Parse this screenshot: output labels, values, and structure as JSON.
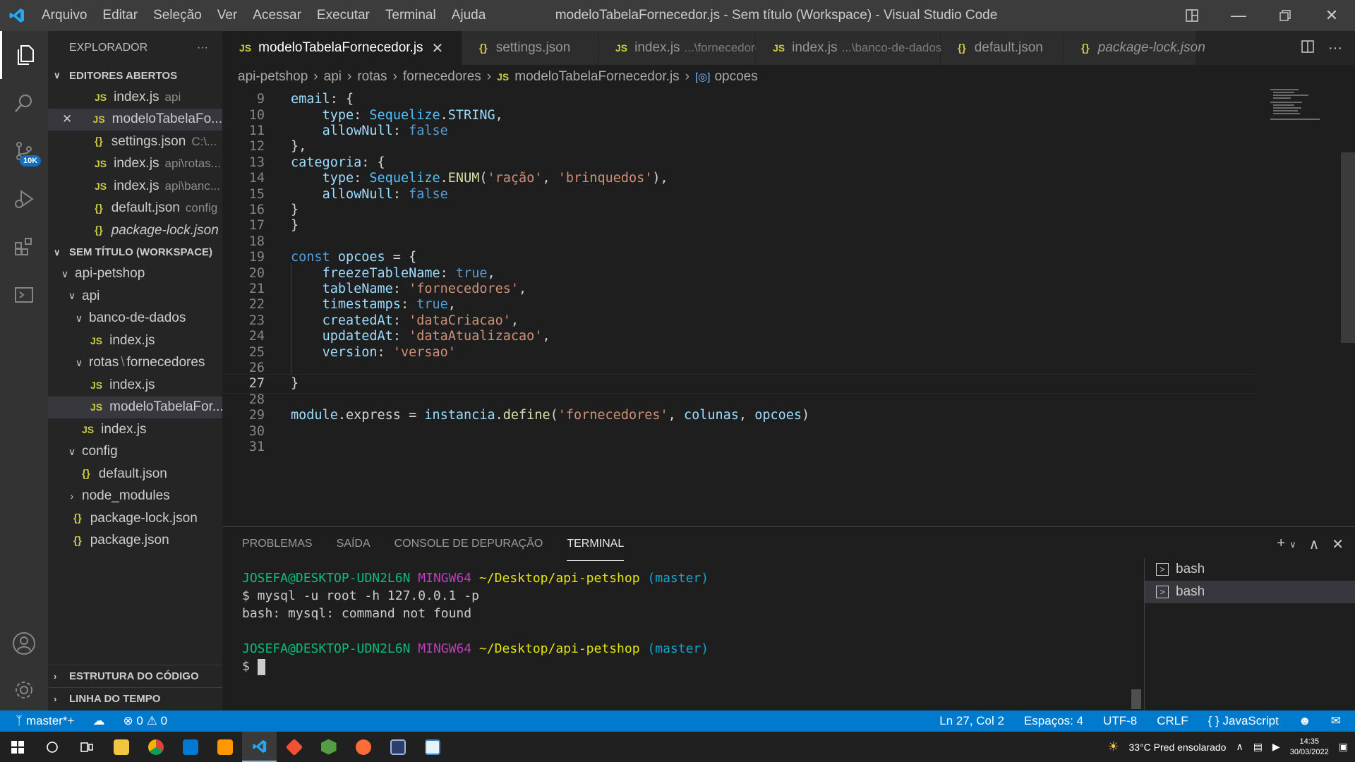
{
  "titlebar": {
    "menu": [
      "Arquivo",
      "Editar",
      "Seleção",
      "Ver",
      "Acessar",
      "Executar",
      "Terminal",
      "Ajuda"
    ],
    "title": "modeloTabelaFornecedor.js - Sem título (Workspace) - Visual Studio Code"
  },
  "activity": {
    "scm_badge": "10K"
  },
  "sidebar": {
    "header": "EXPLORADOR",
    "open_editors": {
      "title": "EDITORES ABERTOS",
      "items": [
        {
          "icon": "js",
          "name": "index.js",
          "desc": "api"
        },
        {
          "icon": "js",
          "name": "modeloTabelaFo...",
          "desc": ""
        },
        {
          "icon": "json",
          "name": "settings.json",
          "desc": "C:\\..."
        },
        {
          "icon": "js",
          "name": "index.js",
          "desc": "api\\rotas..."
        },
        {
          "icon": "js",
          "name": "index.js",
          "desc": "api\\banc..."
        },
        {
          "icon": "json",
          "name": "default.json",
          "desc": "config"
        },
        {
          "icon": "json",
          "name": "package-lock.json",
          "desc": ""
        }
      ]
    },
    "workspace": {
      "title": "SEM TÍTULO (WORKSPACE)",
      "tree": [
        {
          "name": "api-petshop",
          "type": "folder-open"
        },
        {
          "name": "api",
          "type": "folder-open"
        },
        {
          "name": "banco-de-dados",
          "type": "folder-open"
        },
        {
          "name": "index.js",
          "type": "js"
        },
        {
          "name": "rotas",
          "sep": "\\",
          "name2": "fornecedores",
          "type": "folder-open"
        },
        {
          "name": "index.js",
          "type": "js"
        },
        {
          "name": "modeloTabelaFor...",
          "type": "js"
        },
        {
          "name": "index.js",
          "type": "js"
        },
        {
          "name": "config",
          "type": "folder-open"
        },
        {
          "name": "default.json",
          "type": "json"
        },
        {
          "name": "node_modules",
          "type": "folder-closed"
        },
        {
          "name": "package-lock.json",
          "type": "json"
        },
        {
          "name": "package.json",
          "type": "json"
        }
      ]
    },
    "outline": "ESTRUTURA DO CÓDIGO",
    "timeline": "LINHA DO TEMPO"
  },
  "tabs": [
    {
      "icon": "js",
      "label": "modeloTabelaFornecedor.js",
      "desc": "",
      "active": true
    },
    {
      "icon": "json",
      "label": "settings.json",
      "desc": ""
    },
    {
      "icon": "js",
      "label": "index.js",
      "desc": "...\\fornecedores"
    },
    {
      "icon": "js",
      "label": "index.js",
      "desc": "...\\banco-de-dados"
    },
    {
      "icon": "json",
      "label": "default.json",
      "desc": ""
    },
    {
      "icon": "json",
      "label": "package-lock.json",
      "desc": ""
    }
  ],
  "breadcrumb": [
    "api-petshop",
    "api",
    "rotas",
    "fornecedores",
    "modeloTabelaFornecedor.js",
    "opcoes"
  ],
  "editor": {
    "current_line": "27",
    "lines": [
      {
        "n": "9",
        "c": "email: {"
      },
      {
        "n": "10",
        "c": "    type: Sequelize.STRING,"
      },
      {
        "n": "11",
        "c": "    allowNull: false"
      },
      {
        "n": "12",
        "c": "},"
      },
      {
        "n": "13",
        "c": "categoria: {"
      },
      {
        "n": "14",
        "c": "    type: Sequelize.ENUM('ração', 'brinquedos'),"
      },
      {
        "n": "15",
        "c": "    allowNull: false"
      },
      {
        "n": "16",
        "c": "}"
      },
      {
        "n": "17",
        "c": "}"
      },
      {
        "n": "18",
        "c": ""
      },
      {
        "n": "19",
        "c": "const opcoes = {"
      },
      {
        "n": "20",
        "c": "    freezeTableName: true,"
      },
      {
        "n": "21",
        "c": "    tableName: 'fornecedores',"
      },
      {
        "n": "22",
        "c": "    timestamps: true,"
      },
      {
        "n": "23",
        "c": "    createdAt: 'dataCriacao',"
      },
      {
        "n": "24",
        "c": "    updatedAt: 'dataAtualizacao',"
      },
      {
        "n": "25",
        "c": "    version: 'versao'"
      },
      {
        "n": "26",
        "c": ""
      },
      {
        "n": "27",
        "c": "}"
      },
      {
        "n": "28",
        "c": ""
      },
      {
        "n": "29",
        "c": "module.express = instancia.define('fornecedores', colunas, opcoes)"
      },
      {
        "n": "30",
        "c": ""
      },
      {
        "n": "31",
        "c": ""
      }
    ]
  },
  "panel": {
    "tabs": [
      "PROBLEMAS",
      "SAÍDA",
      "CONSOLE DE DEPURAÇÃO",
      "TERMINAL"
    ],
    "active_tab": "TERMINAL",
    "terminal": {
      "user": "JOSEFA@DESKTOP-UDN2L6N",
      "env": "MINGW64",
      "path": "~/Desktop/api-petshop",
      "branch": "(master)",
      "cmd": "$ mysql -u root -h 127.0.0.1 -p",
      "output": "bash: mysql: command not found",
      "prompt": "$"
    },
    "instances": [
      "bash",
      "bash"
    ]
  },
  "statusbar": {
    "branch": "master*+",
    "errors": "0",
    "warnings": "0",
    "position": "Ln 27, Col 2",
    "spaces": "Espaços: 4",
    "encoding": "UTF-8",
    "eol": "CRLF",
    "language": "JavaScript"
  },
  "taskbar": {
    "weather": "33°C  Pred ensolarado",
    "time": "14:35",
    "date": "30/03/2022"
  }
}
